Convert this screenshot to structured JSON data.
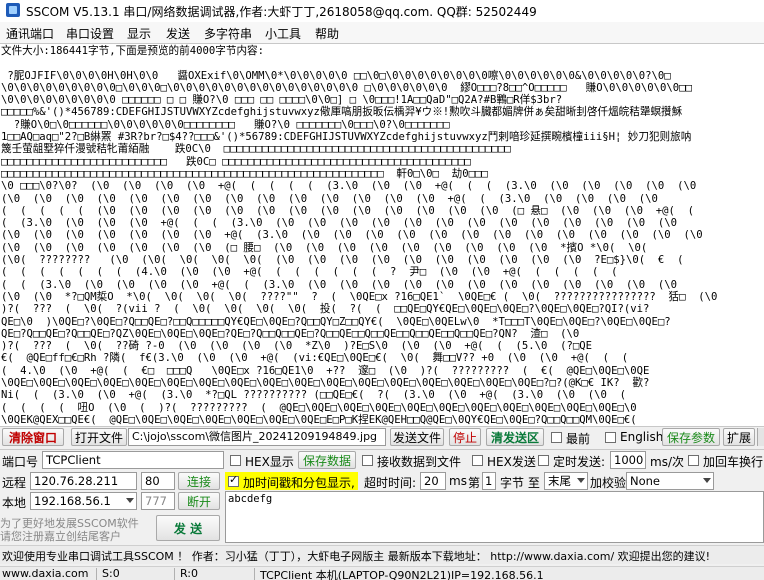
{
  "window": {
    "title": "SSCOM V5.13.1 串口/网络数据调试器,作者:大虾丁丁,2618058@qq.com. QQ群: 52502449"
  },
  "menu": [
    "通讯端口",
    "串口设置",
    "显示",
    "发送",
    "多字符串",
    "小工具",
    "帮助"
  ],
  "main_text": "文件大小:186441字节,下面是预览的前4000字节内容:\n\n ?胒OJFIF\\0\\0\\0\\0H\\0H\\0\\0   醤OXExif\\0\\OMM\\0*\\0\\0\\0\\0\\0 □□\\0□\\0\\0\\0\\0\\0\\0\\0\\0嚓\\0\\0\\0\\0\\0\\0&\\0\\0\\0\\0\\0?\\0□\n\\0\\0\\0\\0\\0\\0\\0\\0\\0□\\0\\0\\0□\\0\\0\\0\\0\\0\\0\\0\\0\\0\\0\\0\\0\\0\\0\\0 □\\0\\0\\0\\0\\0\\0  繆O□□□?8□□^O□□□□□   賺O\\0\\0\\0\\0\\0\\0□□\n\\0\\0\\0\\0\\0\\0\\0\\0\\0 □□□□□□ □ □ 賺O?\\0 □□□ □□ □□□□\\0\\0□] □ \\0□□□!1A□□QaD\"□Q2A?#B鷝□R佯$3br?\n□□□□□%&'()*456789:CDEFGHIJSTUVWXYZcdefghijstuvwxyz儆厙嗃朋扳昄伝楀羿¥ウ※!勲吹斗臓都媚牌併ぁ矣甜晰刲啓仟熅皖秸犟螟攢穌\n  ?賺O\\0□\\0□□□□□□\\0\\0\\0\\0\\0\\0□□□□□□□□   賺O?\\0 □□□□□□□\\0□□□\\0?\\0□□□□□□□\n1□□AQ□aq□\"2?□B綝罴 #3R?br?□$4??□□□&'()*56789:CDEFGHIJSTUVWXYZcdefghijstuvwxyz鬥剌喑珍延撰畹檳橦iii§H¦ 妙刀犯则旅呐\n篾壬萤龃墅猝仟漫號秸牝莆絔融    跌0C\\0  □□□□□□□□□□□□□□□□□□□□□□□□□□□□□□□□□□□□□□□□□□□□□\n□□□□□□□□□□□□□□□□□□□□□□□□□□   跌0C□ □□□□□□□□□□□□□□□□□□□□□□□□□□□□□□□□□□□□□□□\n□□□□□□□□□□□□□□□□□□□□□□□□□□□□□□□□□□□□□□□□□□□□□□□□□□□□□□□□□□□□  軒0□\\0□  劫0□□□\n\\0 □□□\\0?\\0?  (\\0  (\\0  (\\0  (\\0  +@(  (  (  (  (  (3.\\0  (\\0  (\\0  +@(  (  (  (3.\\0  (\\0  (\\0  (\\0  (\\0  (\\0\n(\\0  (\\0  (\\0  (\\0  (\\0  (\\0  (\\0  (\\0  (\\0  (\\0  (\\0  (\\0  (\\0  (\\0  +@(  (  (3.\\0  (\\0  (\\0  (\\0  (\\0\n(  (  (  (  (  (\\0  (\\0  (\\0  (\\0  (\\0  (\\0  (\\0  (\\0  (\\0  (\\0  (\\0  (\\0  (\\0  (□ 悬□  (\\0  (\\0  (\\0  +@(  (\n(  (3.\\0  (\\0  (\\0  (\\0  +@(  (  (  (3.\\0  (\\0  (\\0  (\\0  (\\0  (\\0  (\\0  (\\0  (\\0  (\\0  (\\0  (\\0  (\\0  (\\0\n(\\0  (\\0  (\\0  (\\0  (\\0  (\\0  (\\0  +@(  (3.\\0  (\\0  (\\0  (\\0  (\\0  (\\0  (\\0  (\\0  (\\0  (\\0  (\\0  (\\0  (\\0  (\\0\n(\\0  (\\0  (\\0  (\\0  (\\0  (\\0  (\\0  (□ 腰□  (\\0  (\\0  (\\0  (\\0  (\\0  (\\0  (\\0  (\\0  (\\0  *擯O *\\0(  \\0(\n(\\0(  ????????   (\\0  (\\0(  \\0(  \\0(  \\0(  (\\0  (\\0  (\\0  (\\0  (\\0  (\\0  (\\0  (\\0  (\\0  (\\0  ?E□$}\\0(  €  (\n(  (  (  (  (  (  (  (4.\\0  (\\0  (\\0  +@(  (  (  (  (  (  (  ?  尹□  (\\0  (\\0  +@(  (  (  (  (  (\n(  (  (3.\\0  (\\0  (\\0  (\\0  (\\0  +@(  (  (3.\\0  (\\0  (\\0  (\\0  (\\0  (\\0  (\\0  (\\0  (\\0  (\\0  (\\0  (\\0  (\\0\n(\\0  (\\0  *?□QM梊O  *\\0(  \\0(  \\0(  \\0(  ????\"\"  ?  (  \\0QE□x ?16□QE1`  \\0QE□€ (  \\0(  ????????????????  狧□  (\\0\n)?(  ???  (  \\0(  ?(vii ?  (  \\0(  \\0(  \\0(  \\0(  投(  ?(  (  □□QE□QY€QE□\\0QE□\\0QE□?\\0QE□\\0QE□?QI?(vi?\nQE□\\0  )\\0QE□?\\0QE□?Q□□QE□?□□Q□□□□□QY€QE□\\0QE□?Q□□QY□Z□□QY€(  \\0QE□\\0QELw\\0  *T□□□T\\0QE□\\0QE□?\\0QE□\\0QE□?\nQE□?Q□□QE□?Q□□QE□?QZ\\0QE□\\0QE□\\0QE□?QE□?Q□□Q□□QE□?Q□□QE□□Q□□QE□□Q□□QE□□Q□□QE□?QN?  渣□  (\\0\n)?(  ???  (  \\0(  ??碕 ?-0  (\\0  (\\0  (\\0  (\\0  *Z\\0  )?E□S\\0  (\\0  (\\0  +@(  (  (5.\\0  (?□QE\n€(  @QE□ff□€□Rh ?隣(  f€(3.\\0  (\\0  (\\0  +@(  (vi:€QE□\\0QE□€(  \\0(  舞□□V?? +0  (\\0  (\\0  +@(  (  (\n(  4.\\0  (\\0  +@(  (  €□  □□□Q   \\0QE□x ?16□QE1\\0  +??  邃□  (\\0  )?(  ?????????  (  €(  @QE□\\0QE□\\0QE\n\\0QE□\\0QE□\\0QE□\\0QE□\\0QE□\\0QE□\\0QE□\\0QE□\\0QE□\\0QE□\\0QE□\\0QE□\\0QE□\\0QE□\\0QE□\\0QE□\\0QE□?□?(@K□€ IK?  歡?\nNi(  (  (3.\\0  (\\0  +@(  (3.\\0  *?□QL ?????????? (□□QE□€(  ?(  (3.\\0  (\\0  +@(  (3.\\0  (\\0  (\\0  (\n(  (  (  (  吜O  (\\0  (  )?(  ?????????  (  @QE□\\0QE□\\0QE□\\0QE□\\0QE□\\0QE□\\0QE□\\0QE□\\0QE□\\0QE□\\0QE□\\0\n\\0QEK@QEX□□QE€(  @QE□\\0QE□\\0QE□\\0QE□\\0QE□\\0QE□\\0QE□E□P□K捏EK@QEH□□Q@QE□\\0QY€QE□\\0QE□?Q□□Q□□QM\\0QE□€(",
  "toolbar1": {
    "clear_window": "清除窗口",
    "open_file": "打开文件",
    "file_path": "C:\\jojo\\sscom\\微信图片_20241209194849.jpg",
    "send_file": "发送文件",
    "stop": "停止",
    "clear_send_area": "清发送区",
    "frontmost_label": "最前",
    "english_label": "English",
    "save_params": "保存参数",
    "expand": "扩展"
  },
  "port_row": {
    "port_label": "端口号",
    "port_value": "TCPClient",
    "hex_display_label": "HEX显示",
    "save_data": "保存数据",
    "recv_to_file_label": "接收数据到文件",
    "hex_send_label": "HEX发送",
    "timed_send_label": "定时发送:",
    "interval_value": "1000",
    "interval_unit": "ms/次",
    "add_crlf_label": "加回车换行"
  },
  "remote_row": {
    "label": "远程",
    "ip": "120.76.28.211",
    "port": "80",
    "connect": "连接",
    "timestamp_label": "加时间戳和分包显示,",
    "timeout_label": "超时时间:",
    "timeout_value": "20",
    "timeout_unit": "ms",
    "nth_label": "第",
    "byte_index": "1",
    "byte_to_label": "字节 至",
    "end_select": "末尾",
    "checksum_label": "加校验",
    "checksum_value": "None"
  },
  "local_row": {
    "label": "本地",
    "ip": "192.168.56.1",
    "port": "777",
    "disconnect": "断开"
  },
  "send_area": {
    "text": "abcdefg",
    "send_button": "发 送",
    "promo_line1": "为了更好地发展SSCOM软件",
    "promo_line2": "请您注册嘉立创结尾客户"
  },
  "status_bar": {
    "message": "欢迎使用专业串口调试工具SSCOM ！   作者：习小猛（丁丁），大虾电子网版主  最新版本下载地址： http://www.daxia.com/ 欢迎提出您的建议!"
  },
  "bottom_strip": {
    "website": "www.daxia.com",
    "s_count": "S:0",
    "r_count": "R:0",
    "connection_info": "TCPClient 本机(LAPTOP-Q90N2L21)IP=192.168.56.1"
  },
  "colors": {
    "clear_window_text": "#c00000",
    "timestamp_highlight": "#ffff00",
    "save_button_text": "#1a8a1a",
    "send_button_text": "#0a7a3a"
  },
  "checkboxes": {
    "hex_display": false,
    "recv_to_file": false,
    "hex_send": false,
    "timed_send": false,
    "add_crlf": false,
    "timestamp": true,
    "frontmost": false,
    "english": false
  }
}
